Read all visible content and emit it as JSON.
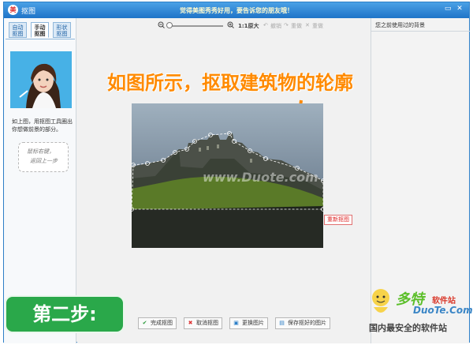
{
  "window": {
    "app_icon": "美",
    "title": "抠图",
    "promo": "觉得美图秀秀好用，要告诉您的朋友哦！",
    "controls": [
      "▭",
      "✕"
    ]
  },
  "left_panel": {
    "tabs": [
      "自动\n抠图",
      "手动\n抠图",
      "形状\n抠图"
    ],
    "hint": "如上图，用抠图工具圈出你想做前景的部分。",
    "sign_lines": [
      "鼠标右键，",
      "返回上一步"
    ]
  },
  "toolbar": {
    "zoom_out_icon": "zoom-out-icon",
    "zoom_in_icon": "zoom-in-icon",
    "zoom_level": 0.1,
    "original_size": "1:1原大",
    "undo": "撤销",
    "redo": "重做",
    "reset": "重做"
  },
  "canvas": {
    "instruction": "如图所示，抠取建筑物的轮廓",
    "photo_watermark": "www.Duote.com",
    "redraw_button": "重新抠图"
  },
  "right_panel": {
    "header": "您之前使用过的背景"
  },
  "step_badge": "第二步:",
  "bottom_buttons": [
    {
      "icon": "✔",
      "label": "完成抠图"
    },
    {
      "icon": "✖",
      "label": "取消抠图"
    },
    {
      "icon": "▣",
      "label": "更换图片"
    },
    {
      "icon": "▤",
      "label": "保存抠好的图片"
    }
  ],
  "watermark": {
    "logo": "多特",
    "small": "软件站",
    "domain": "DuoTe.Com",
    "slogan": "国内最安全的软件站"
  },
  "colors": {
    "accent": "#1f74c8",
    "instruction": "#ff8a00",
    "step_badge": "#2aa84a"
  }
}
